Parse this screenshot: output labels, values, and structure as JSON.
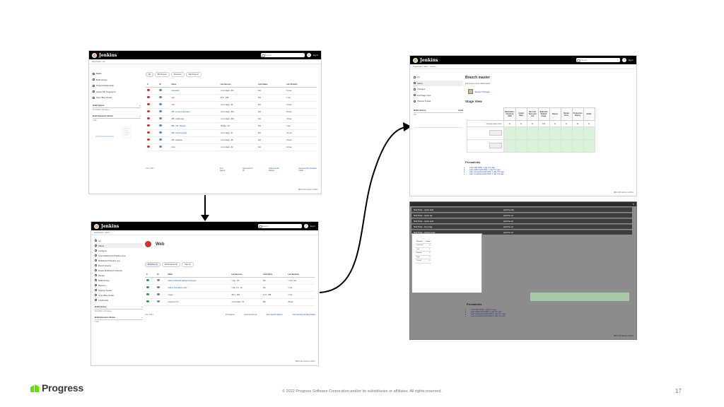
{
  "jenkins": {
    "title": "Jenkins",
    "search_placeholder": "Search",
    "help": "?",
    "login": "log in"
  },
  "shot1": {
    "breadcrumb": "Dashboard  >  All",
    "sidebar": [
      "Builds",
      "Build History",
      "Project Relationship",
      "Check File Fingerprint",
      "Open Blue Ocean"
    ],
    "build_queue_title": "Build Queue",
    "build_queue_text": "No builds in the queue.",
    "executor_title": "Build Executor Status",
    "executor_text": "1 Idle",
    "tabs": [
      "All",
      "MR Projects",
      "Pools Dev",
      "Web Projects"
    ],
    "columns": [
      "S",
      "W",
      "Name",
      "Last Success",
      "Last Failure",
      "Last Duration"
    ],
    "rows": [
      {
        "name": "infra-tests",
        "success": "1 mo 3 days - #11",
        "failure": "N/A",
        "duration": "5.4 sec",
        "status": "red"
      },
      {
        "name": "web",
        "success": "29 hr - #39",
        "failure": "N/A",
        "duration": "1 min",
        "status": "red"
      },
      {
        "name": "API",
        "success": "1 mo 2 days - #6",
        "failure": "N/A",
        "duration": "2.3 sec",
        "status": "red"
      },
      {
        "name": "MB - service-bulk-import",
        "success": "1 mo 2 days - #13",
        "failure": "N/A",
        "duration": "5.3 sec",
        "status": "red"
      },
      {
        "name": "MB - mobile-app",
        "success": "1 mo 4 days - #20",
        "failure": "N/A",
        "duration": "3.8 sec",
        "status": "red"
      },
      {
        "name": "MB - VM - lifecycle",
        "success": "19 days - #4",
        "failure": "N/A",
        "duration": "1 sec",
        "status": "red"
      },
      {
        "name": "MB - test-framework",
        "success": "1 mo 2 days - #7",
        "failure": "N/A",
        "duration": "4.1 sec",
        "status": "red"
      },
      {
        "name": "MB - database",
        "success": "1 mo 3 days - #9",
        "failure": "N/A",
        "duration": "3.6 sec",
        "status": "red"
      },
      {
        "name": "Docs",
        "success": "1 mo 4 days - #2",
        "failure": "N/A",
        "duration": "2.2 sec",
        "status": "red"
      }
    ],
    "icon_label": "Icon: S M L",
    "links": [
      "Icon legend",
      "Atom feed for all",
      "Atom feed for failures",
      "Atom feed for just latest builds"
    ],
    "footer": "REST API    Jenkins 2.263.1"
  },
  "shot2": {
    "breadcrumb": "Dashboard  >  Web  >",
    "heading": "Web",
    "sidebar": [
      "Up",
      "Status",
      "Configure",
      "Scan Multibranch Pipeline Now",
      "Multibranch Pipeline Log",
      "Branch Events",
      "Delete Multibranch Pipeline",
      "People",
      "Build History",
      "Rename",
      "Pipeline Syntax",
      "Open Blue Ocean",
      "Credentials"
    ],
    "build_queue_title": "Build Queue",
    "build_queue_text": "No builds in the queue.",
    "executor_title": "Build Executor Status",
    "executor_text": "1 Idle",
    "tabs": [
      "Branches (4)",
      "Pull Requests (0)",
      "Tags (1)"
    ],
    "columns": [
      "S",
      "W",
      "Name",
      "Last Success",
      "Last Failure",
      "Last Duration"
    ],
    "rows": [
      {
        "name": "feature-1234-add-settings-component",
        "success": "1 day - #3",
        "failure": "N/A",
        "duration": "1 min 1 sec"
      },
      {
        "name": "feature-4321-admin-tools",
        "success": "1 day 3 hr - #2",
        "failure": "N/A",
        "duration": "1 min"
      },
      {
        "name": "master",
        "success": "29 hr - #39",
        "failure": "2 mo - #38",
        "duration": "1 min"
      },
      {
        "name": "release/v2.0.0",
        "success": "1 mo 4 days - #1",
        "failure": "N/A",
        "duration": "45 sec"
      }
    ],
    "icon_label": "Icon: S M L",
    "links": [
      "Icon legend",
      "Atom feed for all",
      "Atom feed for failures",
      "Atom feed for just latest builds"
    ],
    "footer": "REST API    Jenkins 2.263.1"
  },
  "shot3": {
    "breadcrumb": "Dashboard  >  Web  >  master  >",
    "heading": "Branch master",
    "full_name": "Full project name: Web/master",
    "recent_changes": "Recent Changes",
    "stage_view": "Stage View",
    "sidebar": [
      "Up",
      "Status",
      "Changes",
      "Full Stage View",
      "Pipeline Syntax"
    ],
    "build_history": "Build History",
    "trend": "trend",
    "find": "find",
    "columns": [
      "Declarative: Checkout SCM",
      "Install Deps",
      "Run Unit Tests and Lint",
      "Build and Publish Image",
      "Deploy",
      "Smoke Tests",
      "Production Deploy",
      "Notify"
    ],
    "avg_label": "Average stage times:",
    "avg_values": [
      "4s",
      "1s",
      "4s",
      "16s",
      "1s",
      "1s",
      "2s",
      "1s"
    ],
    "permalinks_title": "Permalinks",
    "permalinks": [
      "Last build (#39), 1 day 5 hr ago",
      "Last stable build (#39), 1 day 5 hr ago",
      "Last successful build (#39), 1 day 5 hr ago",
      "Last completed build (#39), 1 day 5 hr ago"
    ],
    "footer": "REST API    Jenkins 2.263.1"
  },
  "shot4": {
    "title": "Stage Logs (Build Image)",
    "log_rows": [
      {
        "text": "Shell Script -- docker build",
        "dur": "(self time 10s)"
      },
      {
        "text": "Shell Script -- docker tag",
        "dur": "(self time 1s)"
      },
      {
        "text": "Shell Script -- docker push",
        "dur": "(self time 4s)"
      },
      {
        "text": "Shell Script -- trivy image",
        "dur": "(self time 1s)"
      },
      {
        "text": "Shell Script -- cleanup image",
        "dur": "(self time 1s)"
      }
    ],
    "table_headers": [
      "Severity",
      "Count"
    ],
    "table_rows": [
      [
        "Unknown",
        "0"
      ],
      [
        "Low",
        "1"
      ],
      [
        "Medium",
        "2"
      ],
      [
        "High",
        "0"
      ],
      [
        "Critical",
        "0"
      ]
    ],
    "permalinks_title": "Permalinks",
    "permalinks": [
      "Last build (#39), 1 day 5 hr ago",
      "Last stable build (#39), 1 day 5 hr ago",
      "Last successful build (#39), 1 day 5 hr ago",
      "Last completed build (#39), 1 day 5 hr ago"
    ],
    "footer": "REST API    Jenkins 2.263.1"
  },
  "slide": {
    "brand": "Progress",
    "copyright": "© 2022 Progress Software Corporation and/or its subsidiaries or affiliates. All rights reserved.",
    "page_number": "17",
    "brand_color": "#5ce500"
  }
}
